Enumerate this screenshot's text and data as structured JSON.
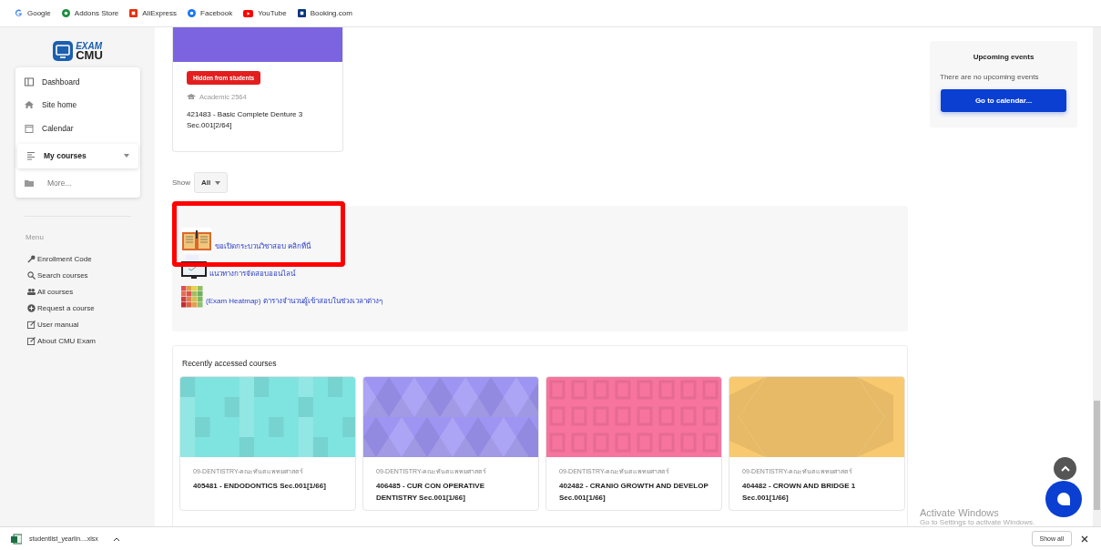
{
  "bookmarks": [
    {
      "label": "Google",
      "kind": "google"
    },
    {
      "label": "Addons Store",
      "kind": "addons"
    },
    {
      "label": "AliExpress",
      "kind": "ali"
    },
    {
      "label": "Facebook",
      "kind": "facebook"
    },
    {
      "label": "YouTube",
      "kind": "youtube"
    },
    {
      "label": "Booking.com",
      "kind": "booking"
    }
  ],
  "logo": {
    "line1": "EXAM",
    "line2": "CMU"
  },
  "nav": [
    {
      "label": "Dashboard",
      "kind": "dashboard",
      "selected": false
    },
    {
      "label": "Site home",
      "kind": "home",
      "selected": false
    },
    {
      "label": "Calendar",
      "kind": "calendar",
      "selected": false
    },
    {
      "label": "My courses",
      "kind": "courses",
      "selected": true,
      "expanded": false
    },
    {
      "label": "More...",
      "kind": "more",
      "selected": false
    }
  ],
  "menu": {
    "title": "Menu",
    "items": [
      {
        "label": "Enrollment Code",
        "kind": "key"
      },
      {
        "label": "Search courses",
        "kind": "search"
      },
      {
        "label": "All courses",
        "kind": "group"
      },
      {
        "label": "Request a course",
        "kind": "plus"
      },
      {
        "label": "User manual",
        "kind": "edit"
      },
      {
        "label": "About CMU Exam",
        "kind": "edit"
      }
    ]
  },
  "top_course": {
    "color": "#7c63e0",
    "badge": "Hidden from students",
    "category": "Academic 2564",
    "title": "421483 - Basic Complete Denture 3 Sec.001[2/64]"
  },
  "show_filter": {
    "label": "Show",
    "value": "All"
  },
  "links": [
    {
      "label": "ขอเปิดกระบวนวิชาสอบ คลิกที่นี่",
      "kind": "book",
      "highlighted": true
    },
    {
      "label": "แนวทางการจัดสอบออนไลน์",
      "kind": "monitor",
      "highlighted": false
    },
    {
      "label": "(Exam Heatmap) ตารางจำนวนผู้เข้าสอบในช่วงเวลาต่างๆ",
      "kind": "heatmap",
      "highlighted": false
    }
  ],
  "recent": {
    "title": "Recently accessed courses",
    "courses": [
      {
        "category": "09-DENTISTRY-คณะทันตแพทยศาสตร์",
        "title": "405481 - ENDODONTICS Sec.001[1/66]",
        "color": "#7fe3e0",
        "kind": "squares"
      },
      {
        "category": "09-DENTISTRY-คณะทันตแพทยศาสตร์",
        "title": "406485 - CUR CON OPERATIVE DENTISTRY Sec.001[1/66]",
        "color": "#9e94f2",
        "kind": "triangles"
      },
      {
        "category": "09-DENTISTRY-คณะทันตแพทยศาสตร์",
        "title": "402482 - CRANIO GROWTH AND DEVELOP Sec.001[1/66]",
        "color": "#f7749f",
        "kind": "boxes"
      },
      {
        "category": "09-DENTISTRY-คณะทันตแพทยศาสตร์",
        "title": "404482 - CROWN AND BRIDGE 1 Sec.001[1/66]",
        "color": "#f8c96e",
        "kind": "hexagons"
      }
    ]
  },
  "upcoming": {
    "title": "Upcoming events",
    "message": "There are no upcoming events",
    "button": "Go to calendar..."
  },
  "os_notice": {
    "title": "Activate Windows",
    "subtitle": "Go to Settings to activate Windows."
  },
  "download_bar": {
    "file": "studentlist_yearlin....xlsx",
    "button": "Show all"
  }
}
